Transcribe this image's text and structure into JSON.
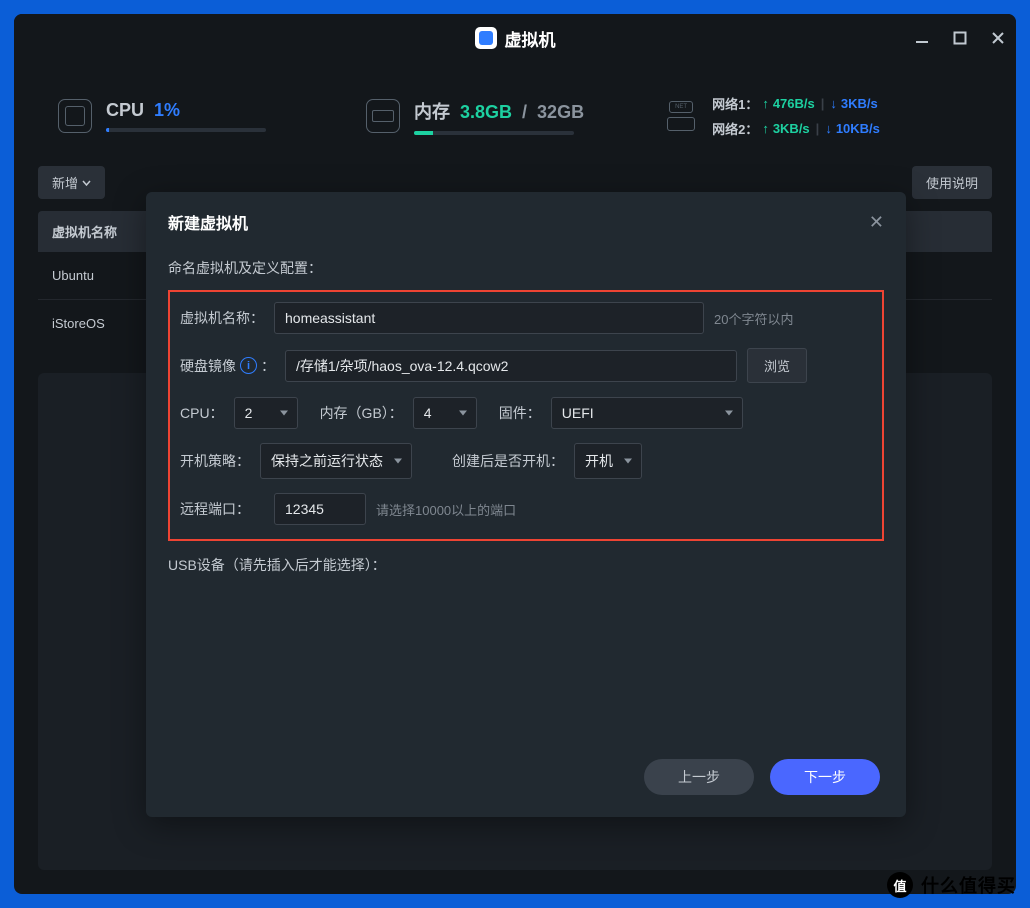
{
  "titlebar": {
    "title": "虚拟机"
  },
  "stats": {
    "cpu": {
      "label": "CPU",
      "value": "1%"
    },
    "mem": {
      "label": "内存",
      "used": "3.8GB",
      "total": "32GB"
    },
    "net": {
      "iconLabel": "NET",
      "row1": {
        "label": "网络1：",
        "up": "476B/s",
        "down": "3KB/s"
      },
      "row2": {
        "label": "网络2：",
        "up": "3KB/s",
        "down": "10KB/s"
      }
    }
  },
  "toolbar": {
    "add": "新增",
    "help": "使用说明"
  },
  "table": {
    "header": "虚拟机名称",
    "rows": [
      "Ubuntu",
      "iStoreOS"
    ]
  },
  "modal": {
    "title": "新建虚拟机",
    "section": "命名虚拟机及定义配置：",
    "name": {
      "label": "虚拟机名称：",
      "value": "homeassistant",
      "hint": "20个字符以内"
    },
    "disk": {
      "label": "硬盘镜像",
      "colon": "：",
      "value": "/存储1/杂项/haos_ova-12.4.qcow2",
      "browse": "浏览"
    },
    "cpu": {
      "label": "CPU：",
      "value": "2"
    },
    "mem": {
      "label": "内存（GB）：",
      "value": "4"
    },
    "firmware": {
      "label": "固件：",
      "value": "UEFI"
    },
    "boot": {
      "label": "开机策略：",
      "value": "保持之前运行状态"
    },
    "afterCreate": {
      "label": "创建后是否开机：",
      "value": "开机"
    },
    "port": {
      "label": "远程端口：",
      "value": "12345",
      "hint": "请选择10000以上的端口"
    },
    "usb": "USB设备（请先插入后才能选择）：",
    "prev": "上一步",
    "next": "下一步"
  },
  "watermark": {
    "badge": "值",
    "text": "什么值得买"
  }
}
